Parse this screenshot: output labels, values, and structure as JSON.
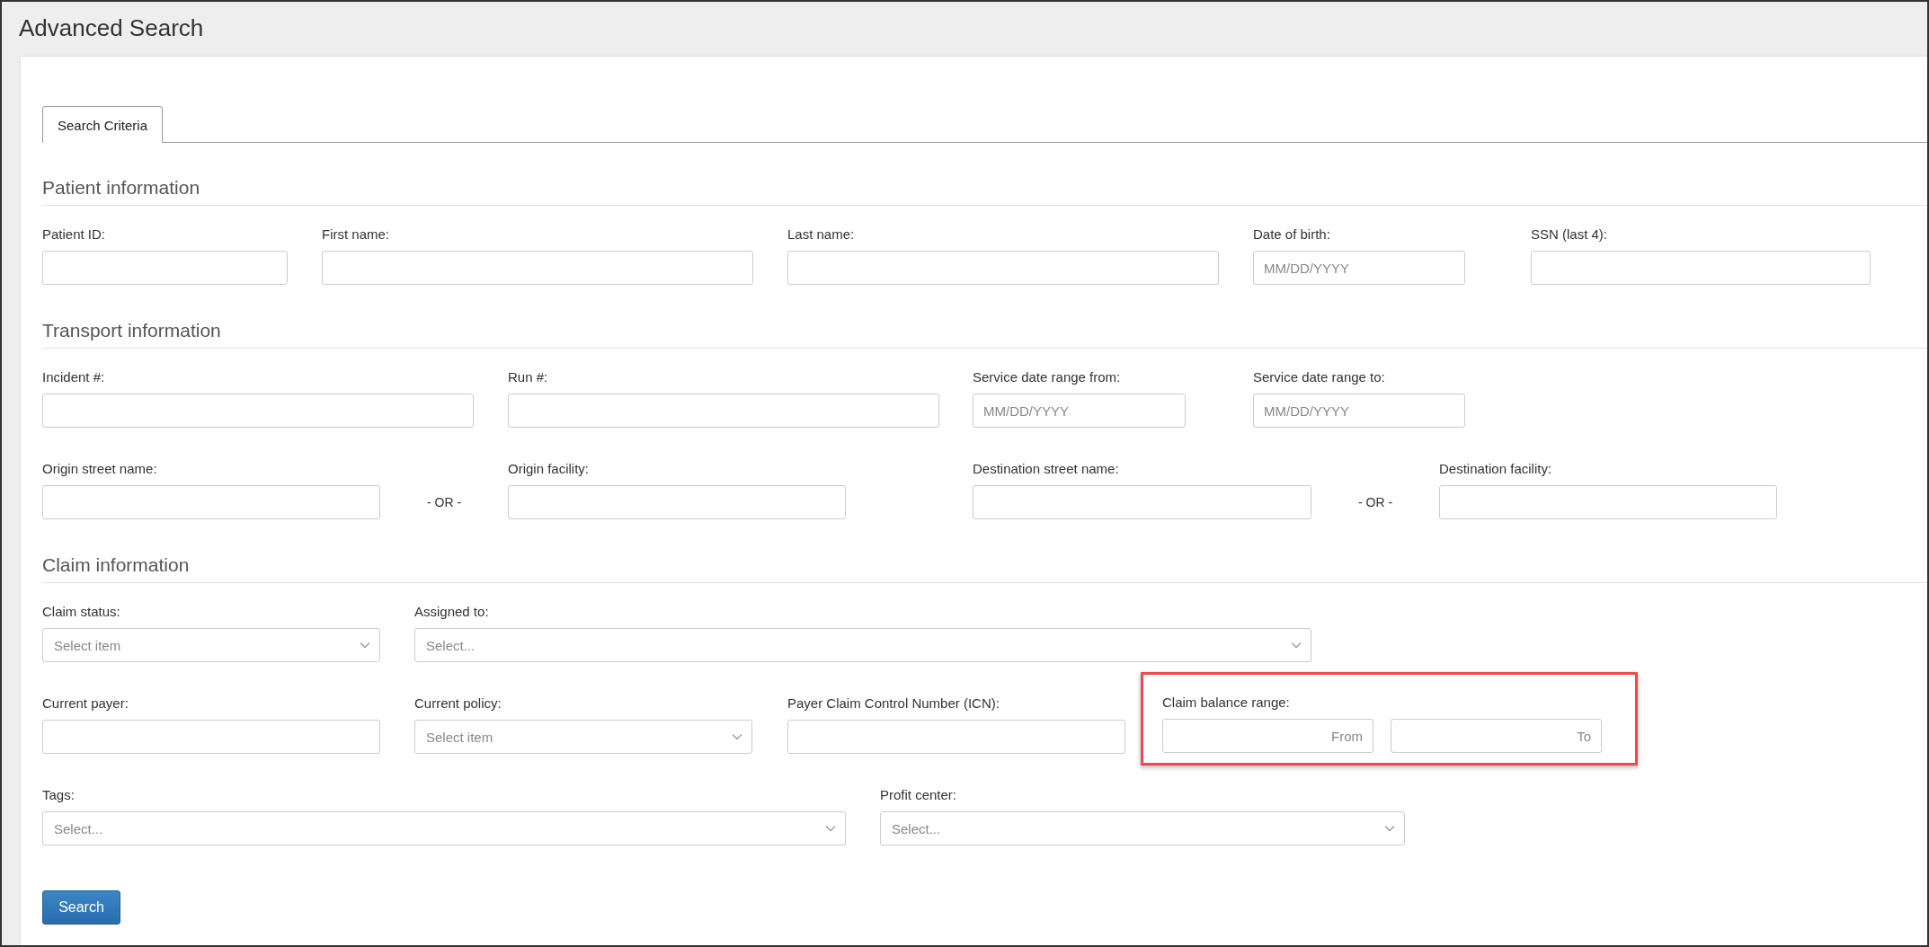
{
  "page": {
    "title": "Advanced Search"
  },
  "tabs": [
    {
      "label": "Search Criteria",
      "selected": true
    }
  ],
  "sections": [
    {
      "heading": "Patient information",
      "fields": [
        {
          "kind": "text",
          "label": "Patient ID:"
        },
        {
          "kind": "text",
          "label": "First name:"
        },
        {
          "kind": "text",
          "label": "Last name:"
        },
        {
          "kind": "text",
          "label": "Date of birth:",
          "placeholder": "MM/DD/YYYY"
        },
        {
          "kind": "text",
          "label": "SSN (last 4):"
        }
      ]
    },
    {
      "heading": "Transport information",
      "fields": [
        {
          "kind": "text",
          "label": "Incident #:"
        },
        {
          "kind": "text",
          "label": "Run #:"
        },
        {
          "kind": "text",
          "label": "Service date range from:",
          "placeholder": "MM/DD/YYYY"
        },
        {
          "kind": "text",
          "label": "Service date range to:",
          "placeholder": "MM/DD/YYYY"
        },
        {
          "kind": "text",
          "label": "Origin street name:"
        },
        {
          "kind": "separator",
          "text": "- OR -"
        },
        {
          "kind": "text",
          "label": "Origin facility:"
        },
        {
          "kind": "text",
          "label": "Destination street name:"
        },
        {
          "kind": "separator",
          "text": "- OR -"
        },
        {
          "kind": "text",
          "label": "Destination facility:"
        }
      ]
    },
    {
      "heading": "Claim information",
      "fields": [
        {
          "kind": "select",
          "label": "Claim status:",
          "placeholder": "Select item"
        },
        {
          "kind": "select",
          "label": "Assigned to:",
          "placeholder": "Select..."
        },
        {
          "kind": "text",
          "label": "Current payer:"
        },
        {
          "kind": "select",
          "label": "Current policy:",
          "placeholder": "Select item"
        },
        {
          "kind": "text",
          "label": "Payer Claim Control Number (ICN):"
        },
        {
          "kind": "range",
          "label": "Claim balance range:",
          "highlighted": true,
          "from_placeholder": "From",
          "to_placeholder": "To"
        },
        {
          "kind": "select",
          "label": "Tags:",
          "placeholder": "Select..."
        },
        {
          "kind": "select",
          "label": "Profit center:",
          "placeholder": "Select..."
        }
      ]
    }
  ],
  "search_button": "Search"
}
